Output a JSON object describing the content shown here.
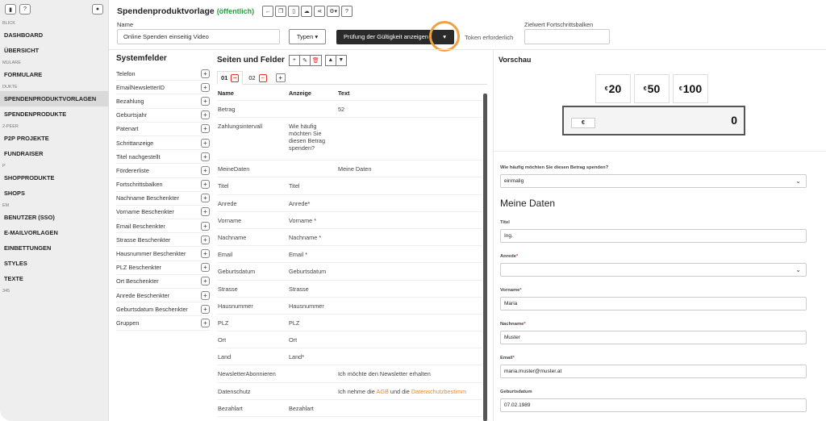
{
  "sidebar": {
    "top_left_icon": "help-icon",
    "top_right_icon": "user-circle-icon",
    "sections": [
      {
        "label": "BLICK",
        "items": [
          "DASHBOARD",
          "ÜBERSICHT"
        ]
      },
      {
        "label": "MULARE",
        "items": [
          "FORMULARE"
        ]
      },
      {
        "label": "DUKTE",
        "items": [
          "SPENDENPRODUKTVORLAGEN",
          "SPENDENPRODUKTE"
        ]
      },
      {
        "label": "2-PEER",
        "items": [
          "P2P PROJEKTE",
          "FUNDRAISER"
        ]
      },
      {
        "label": "P",
        "items": [
          "SHOPPRODUKTE",
          "SHOPS"
        ]
      },
      {
        "label": "EM",
        "items": [
          "BENUTZER (SSO)",
          "E-MAILVORLAGEN",
          "EINBETTUNGEN",
          "STYLES",
          "TEXTE"
        ]
      },
      {
        "label": "345",
        "items": []
      }
    ],
    "active_item": "SPENDENPRODUKTVORLAGEN"
  },
  "header": {
    "title": "Spendenproduktvorlage",
    "status": "(öffentlich)",
    "name_label": "Name",
    "name_value": "Online Spenden einseitig Video",
    "types_label": "Typen",
    "validation_label": "Prüfung der Gültigkeit anzeigen",
    "token_label": "Token erforderlich",
    "target_label": "Zielwert Fortschrittsbalken",
    "target_value": ""
  },
  "system_fields": {
    "title": "Systemfelder",
    "items": [
      "Telefon",
      "EmailNewsletterID",
      "Bezahlung",
      "Geburtsjahr",
      "Patenart",
      "Schrittanzeige",
      "Titel nachgestellt",
      "Fördererliste",
      "Fortschrittsbalken",
      "Nachname Beschenkter",
      "Vorname Beschenkter",
      "Email Beschenkter",
      "Strasse Beschenkter",
      "Hausnummer Beschenkter",
      "PLZ Beschenkter",
      "Ort Beschenkter",
      "Anrede Beschenkter",
      "Geburtsdatum Beschenkter",
      "Gruppen"
    ]
  },
  "pages": {
    "title": "Seiten und Felder",
    "tabs": [
      {
        "label": "01"
      },
      {
        "label": "02"
      }
    ],
    "columns": [
      "Name",
      "Anzeige",
      "Text"
    ],
    "rows": [
      {
        "name": "Betrag",
        "display": "",
        "text": "52"
      },
      {
        "name": "Zahlungsintervall",
        "display": "Wie häufig möchten Sie diesen Betrag spenden?",
        "text": ""
      },
      {
        "name": "MeineDaten",
        "display": "",
        "text": "Meine Daten"
      },
      {
        "name": "Titel",
        "display": "Titel",
        "text": ""
      },
      {
        "name": "Anrede",
        "display": "Anrede*",
        "text": ""
      },
      {
        "name": "Vorname",
        "display": "Vorname *",
        "text": ""
      },
      {
        "name": "Nachname",
        "display": "Nachname *",
        "text": ""
      },
      {
        "name": "Email",
        "display": "Email *",
        "text": ""
      },
      {
        "name": "Geburtsdatum",
        "display": "Geburtsdatum",
        "text": ""
      },
      {
        "name": "Strasse",
        "display": "Strasse",
        "text": ""
      },
      {
        "name": "Hausnummer",
        "display": "Hausnummer",
        "text": ""
      },
      {
        "name": "PLZ",
        "display": "PLZ",
        "text": ""
      },
      {
        "name": "Ort",
        "display": "Ort",
        "text": ""
      },
      {
        "name": "Land",
        "display": "Land*",
        "text": ""
      },
      {
        "name": "NewsletterAbonnieren",
        "display": "",
        "text": "Ich möchte den Newsletter erhalten"
      },
      {
        "name": "Datenschutz",
        "display": "",
        "text": "Ich nehme die ",
        "link1": "AGB",
        "mid": " und die ",
        "link2": "Datenschutzbestimm"
      },
      {
        "name": "Bezahlart",
        "display": "Bezahlart",
        "text": ""
      }
    ]
  },
  "preview": {
    "title": "Vorschau",
    "currency_symbol": "€",
    "amounts": [
      "20",
      "50",
      "100"
    ],
    "custom_currency": "€",
    "custom_value": "0",
    "interval_label": "Wie häufig möchten Sie diesen Betrag spenden?",
    "interval_value": "einmalig",
    "section_heading": "Meine Daten",
    "fields": [
      {
        "label": "Titel",
        "required": false,
        "value": "Ing.",
        "select": false
      },
      {
        "label": "Anrede",
        "required": true,
        "value": "",
        "select": true
      },
      {
        "label": "Vorname",
        "required": true,
        "value": "Maria",
        "select": false
      },
      {
        "label": "Nachname",
        "required": true,
        "value": "Muster",
        "select": false
      },
      {
        "label": "Email",
        "required": true,
        "value": "maria.muster@muster.at",
        "select": false
      },
      {
        "label": "Geburtsdatum",
        "required": false,
        "value": "07.02.1989",
        "select": false
      }
    ]
  },
  "colors": {
    "accent_public": "#2e9e3e",
    "cursor_ring": "#f0a040",
    "link": "#e88a2a",
    "delete": "#dd3333"
  }
}
